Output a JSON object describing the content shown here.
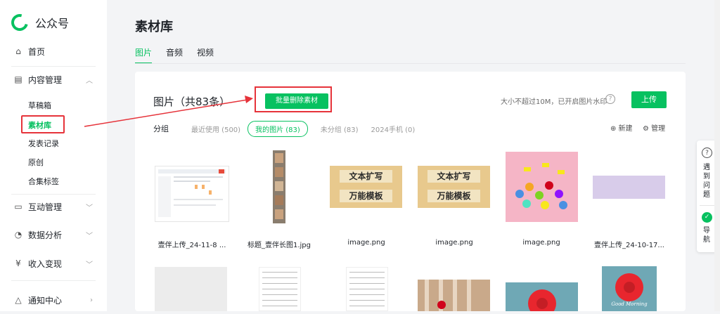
{
  "app": {
    "name": "公众号"
  },
  "sidebar": {
    "items": [
      {
        "label": "首页",
        "icon": "home-icon"
      },
      {
        "label": "内容管理",
        "icon": "document-icon"
      },
      {
        "label": "互动管理",
        "icon": "chat-icon"
      },
      {
        "label": "数据分析",
        "icon": "pie-chart-icon"
      },
      {
        "label": "收入变现",
        "icon": "yen-icon"
      },
      {
        "label": "通知中心",
        "icon": "bell-icon"
      }
    ],
    "sub_items": [
      "草稿箱",
      "素材库",
      "发表记录",
      "原创",
      "合集标签"
    ]
  },
  "main": {
    "title": "素材库",
    "tabs": [
      "图片",
      "音频",
      "视频"
    ],
    "panel_title": "图片（共83条）",
    "batch_delete": "批量删除素材",
    "size_hint": "大小不超过10M，已开启图片水印",
    "help": "?",
    "upload": "上传",
    "groups_label": "分组",
    "groups": [
      "最近使用 (500)",
      "我的图片 (83)",
      "未分组 (83)",
      "2024手机 (0)"
    ],
    "new_group": "⊕ 新建",
    "manage": "⚙ 管理",
    "images": [
      "壹伴上传_24-11-8 ...",
      "标题_壹伴长图1.jpg",
      "image.png",
      "image.png",
      "image.png",
      "壹伴上传_24-10-17..."
    ],
    "poster_line1": "文本扩写",
    "poster_line2": "万能模板",
    "good_morning": "Good Morning"
  },
  "float_bar": {
    "help": "遇到问题",
    "nav": "导航"
  },
  "colors": {
    "accent": "#07c160",
    "annotation": "#e6333a"
  }
}
